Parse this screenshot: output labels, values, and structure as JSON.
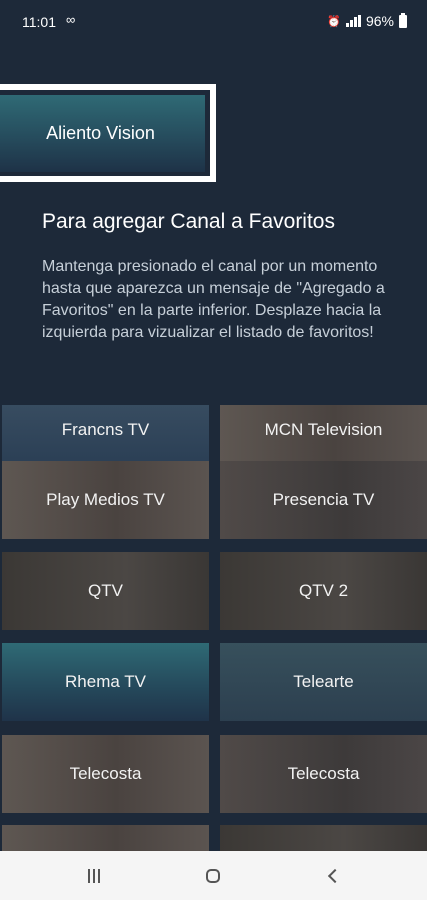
{
  "status_bar": {
    "time": "11:01",
    "link_icon": "∞",
    "battery": "96%"
  },
  "highlight": {
    "channel": "Aliento Vision"
  },
  "hint": {
    "title": "Para agregar Canal a Favoritos",
    "body": "Mantenga presionado el canal por un momento hasta que aparezca un mensaje de \"Agregado a Favoritos\" en la parte inferior. Desplaze hacia la izquierda para vizualizar el listado de favoritos!"
  },
  "channels": {
    "row0": {
      "left": "Francns TV",
      "right": "MCN Television"
    },
    "row1": {
      "left": "Play Medios TV",
      "right": "Presencia TV"
    },
    "row2": {
      "left": "QTV",
      "right": "QTV 2"
    },
    "row3": {
      "left": "Rhema TV",
      "right": "Telearte"
    },
    "row4": {
      "left": "Telecosta",
      "right": "Telecosta"
    },
    "row5": {
      "left": "",
      "right": ""
    }
  }
}
